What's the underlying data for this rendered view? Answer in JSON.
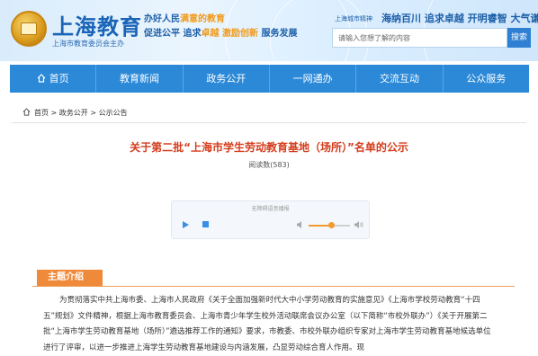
{
  "header": {
    "logo_title": "上海教育",
    "logo_sub": "上海市教育委员会主办",
    "slogan1_pre": "办好人民",
    "slogan1_hl": "满意的教育",
    "slogan2_pre": "促进公平 追求",
    "slogan2_hl": "卓越 激励创新",
    "slogan2_post": " 服务发展",
    "spirit_label": "上海城市精神",
    "spirit_text": "海纳百川 追求卓越 开明睿智 大气谦和",
    "search_placeholder": "请输入您想了解的内容",
    "search_button": "搜索"
  },
  "nav": {
    "items": [
      {
        "label": "首页"
      },
      {
        "label": "教育新闻"
      },
      {
        "label": "政务公开"
      },
      {
        "label": "一网通办"
      },
      {
        "label": "交流互动"
      },
      {
        "label": "公众服务"
      }
    ]
  },
  "breadcrumb": {
    "home": "首页",
    "sep1": " > ",
    "level1": "政务公开",
    "sep2": " > ",
    "level2": "公示公告"
  },
  "article": {
    "title": "关于第二批“上海市学生劳动教育基地（场所）”名单的公示",
    "read_count": "阅读数(583)"
  },
  "player": {
    "label": "无障碍语音播报",
    "volume_level": 0.55,
    "accent": "#f29a2e"
  },
  "section": {
    "title": "主题介绍"
  },
  "body": {
    "paragraph": "为贯彻落实中共上海市委、上海市人民政府《关于全面加强新时代大中小学劳动教育的实施意见》《上海市学校劳动教育“十四五”规划》文件精神，根据上海市教育委员会、上海市青少年学生校外活动联席会议办公室（以下简称“市校外联办”）《关于开展第二批“上海市学生劳动教育基地（场所）”遴选推荐工作的通知》要求，市教委、市校外联办组织专家对上海市学生劳动教育基地候选单位进行了评审，以进一步推进上海学生劳动教育基地建设与内涵发展，凸显劳动综合育人作用。现"
  },
  "colors": {
    "brand": "#1a64b8",
    "nav": "#2b89d8",
    "title_red": "#d43d1d",
    "section_orange": "#ef8a3a"
  }
}
